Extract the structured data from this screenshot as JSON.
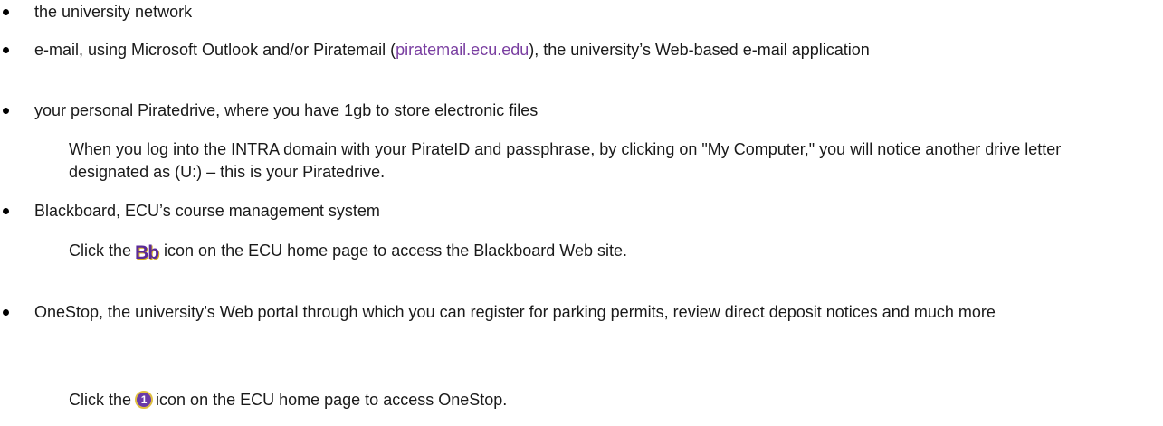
{
  "items": [
    {
      "text": "the university network"
    },
    {
      "pre": "e-mail, using Microsoft Outlook and/or Piratemail (",
      "link": "piratemail.ecu.edu",
      "post": "), the university’s Web-based e-mail application"
    },
    {
      "text": "your personal Piratedrive, where you have 1gb to store electronic files"
    },
    {
      "text": "Blackboard, ECU’s course management system"
    },
    {
      "text": "OneStop, the university’s Web portal through which you can register for parking permits, review direct deposit notices and much more"
    }
  ],
  "notes": {
    "piratedrive": "When you log into the INTRA domain with your PirateID and passphrase, by clicking on \"My Computer,\" you will notice another drive letter designated as (U:) – this is your Piratedrive.",
    "blackboard_pre": "Click the",
    "blackboard_icon": "Bb",
    "blackboard_post": "icon on the ECU home page to access the Blackboard Web site.",
    "onestop_pre": "Click the",
    "onestop_icon": "1",
    "onestop_post": "icon on the ECU home page to access OneStop."
  },
  "colors": {
    "link": "#7a3fa1"
  }
}
